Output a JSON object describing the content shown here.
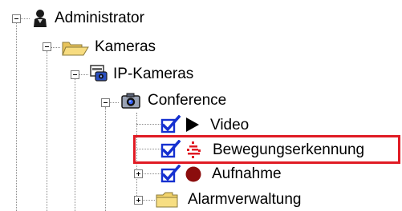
{
  "tree": {
    "nodes": [
      {
        "label": "Administrator",
        "icon": "person-icon"
      },
      {
        "label": "Kameras",
        "icon": "folder-open-icon"
      },
      {
        "label": "IP-Kameras",
        "icon": "ip-camera-group-icon"
      },
      {
        "label": "Conference",
        "icon": "camera-icon"
      },
      {
        "label": "Video",
        "icon": "play-icon",
        "checked": true
      },
      {
        "label": "Bewegungserkennung",
        "icon": "motion-detection-icon",
        "checked": true,
        "highlighted": true
      },
      {
        "label": "Aufnahme",
        "icon": "record-icon",
        "checked": true
      },
      {
        "label": "Alarmverwaltung",
        "icon": "folder-icon"
      }
    ]
  },
  "colors": {
    "highlight": "#e01b24",
    "checkbox": "#1530d0",
    "folder": "#f2d36b",
    "record": "#8b0d0d"
  }
}
